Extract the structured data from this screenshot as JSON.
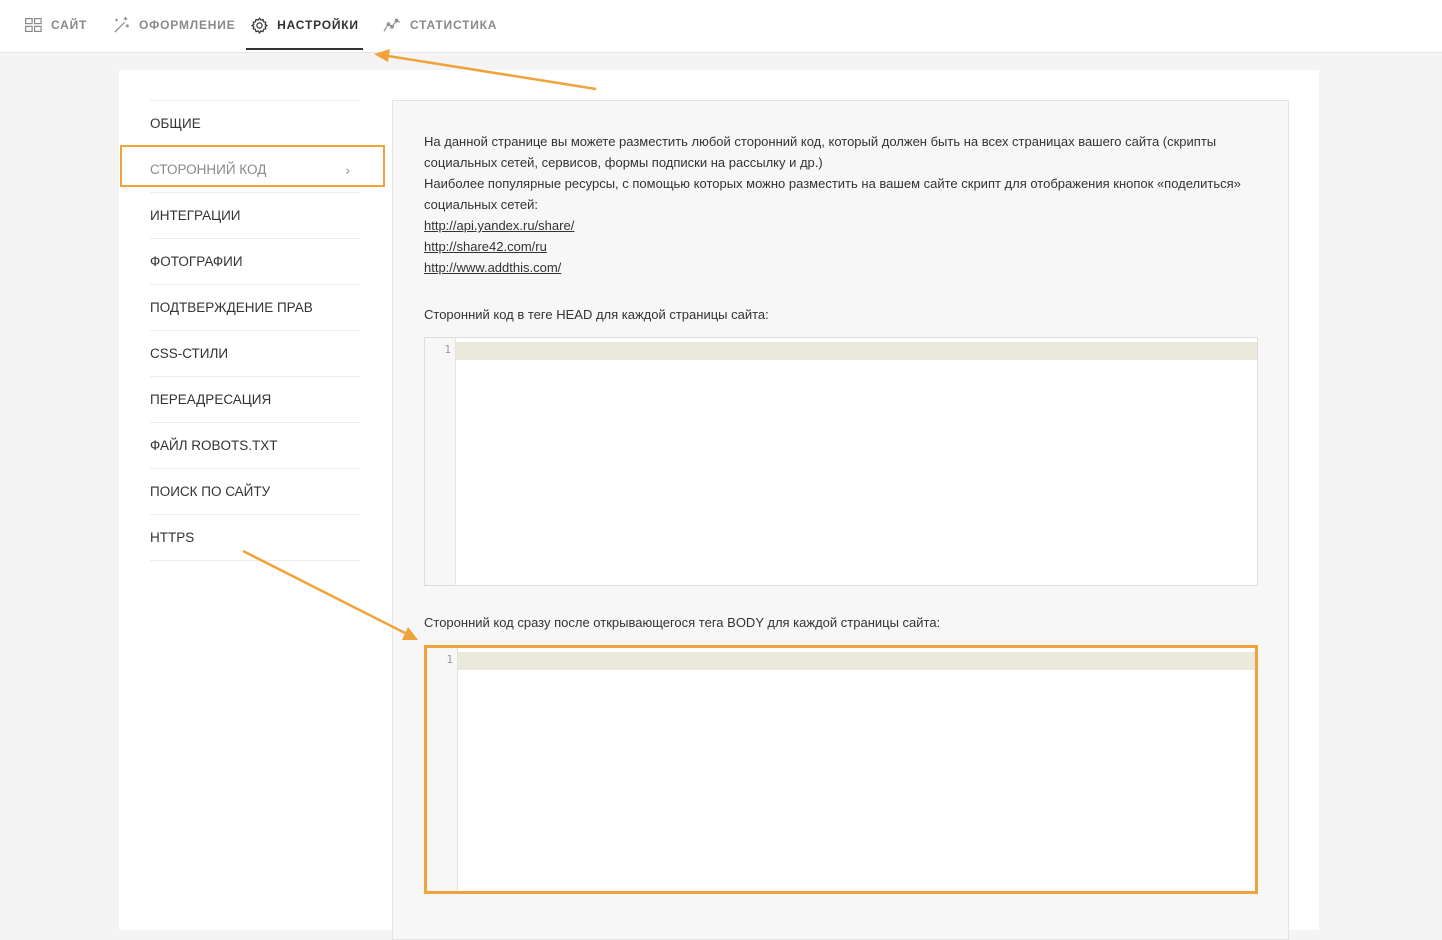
{
  "nav": {
    "tabs": [
      {
        "label": "САЙТ",
        "icon": "grid-icon"
      },
      {
        "label": "ОФОРМЛЕНИЕ",
        "icon": "magic-wand-icon"
      },
      {
        "label": "НАСТРОЙКИ",
        "icon": "gear-icon",
        "active": true
      },
      {
        "label": "СТАТИСТИКА",
        "icon": "chart-line-icon"
      }
    ]
  },
  "sidebar": {
    "items": [
      {
        "label": "ОБЩИЕ"
      },
      {
        "label": "СТОРОННИЙ КОД",
        "active": true
      },
      {
        "label": "ИНТЕГРАЦИИ"
      },
      {
        "label": "ФОТОГРАФИИ"
      },
      {
        "label": "ПОДТВЕРЖДЕНИЕ ПРАВ"
      },
      {
        "label": "CSS-СТИЛИ"
      },
      {
        "label": "ПЕРЕАДРЕСАЦИЯ"
      },
      {
        "label": "ФАЙЛ ROBOTS.TXT"
      },
      {
        "label": "ПОИСК ПО САЙТУ"
      },
      {
        "label": "HTTPS"
      }
    ],
    "chevron": "›"
  },
  "main": {
    "intro_line1": "На данной странице вы можете разместить любой сторонний код, который должен быть на всех страницах вашего сайта (скрипты",
    "intro_line2": "социальных сетей, сервисов, формы подписки на рассылку и др.)",
    "intro_line3": "Наиболее популярные ресурсы, с помощью которых можно разместить на вашем сайте скрипт для отображения кнопок «поделиться»",
    "intro_line4": "социальных сетей:",
    "links": [
      "http://api.yandex.ru/share/",
      "http://share42.com/ru",
      "http://www.addthis.com/"
    ],
    "head_label": "Сторонний код в теге HEAD для каждой страницы сайта:",
    "body_label": "Сторонний код сразу после открывающегося тега BODY для каждой страницы сайта:",
    "line_number": "1"
  },
  "colors": {
    "highlight": "#f0a33b",
    "active_line": "#ebe8dc"
  }
}
